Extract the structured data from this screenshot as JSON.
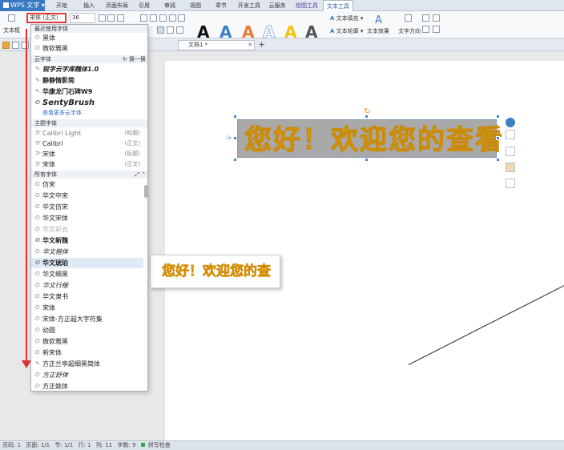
{
  "menubar": {
    "app_label": "WPS 文字",
    "tabs": [
      {
        "label": "开始"
      },
      {
        "label": "插入"
      },
      {
        "label": "页面布局"
      },
      {
        "label": "引用"
      },
      {
        "label": "审阅"
      },
      {
        "label": "视图"
      },
      {
        "label": "章节"
      },
      {
        "label": "开发工具"
      },
      {
        "label": "云服务"
      },
      {
        "label": "绘图工具"
      },
      {
        "label": "文本工具"
      }
    ],
    "active_tab": "文本工具"
  },
  "ribbon": {
    "font_name": "宋体 (正文)",
    "font_size": "36",
    "textbox_label": "文本框",
    "text_fill_label": "文本填充",
    "text_outline_label": "文本轮廓",
    "text_effect_label": "文本效果",
    "text_direction_label": "文字方向",
    "style_glyph": "A",
    "style_colors": [
      "#111111",
      "#3c7fc6",
      "#e87a3a",
      "#9ab4d6",
      "#f1c40f",
      "#555555"
    ]
  },
  "document_tab": {
    "label": "文档1 *"
  },
  "wordart": {
    "text": "您好！欢迎您的查看",
    "fill_color": "#e3ad19"
  },
  "preview": {
    "text": "您好！欢迎您的查"
  },
  "font_dropdown": {
    "recent_header": "最近使用字体",
    "recent": [
      {
        "name": "黑体"
      },
      {
        "name": "微软雅黑"
      }
    ],
    "cloud_header": "云字体",
    "cloud_action": "换一换",
    "cloud": [
      {
        "name": "锐字云字库魏体1.0"
      },
      {
        "name": "静静情影简"
      },
      {
        "name": "华康龙门石碑W9"
      },
      {
        "name": "SentyBrush"
      }
    ],
    "cloud_more": "查看更多云字体",
    "theme_header": "主题字体",
    "theme": [
      {
        "name": "Calibri Light",
        "tag": "(标题)"
      },
      {
        "name": "Calibri",
        "tag": "(正文)"
      },
      {
        "name": "宋体",
        "tag": "(标题)"
      },
      {
        "name": "宋体",
        "tag": "(正文)"
      }
    ],
    "all_header": "所有字体",
    "all": [
      {
        "name": "仿宋"
      },
      {
        "name": "华文中宋"
      },
      {
        "name": "华文仿宋"
      },
      {
        "name": "华文宋体"
      },
      {
        "name": "华文彩云"
      },
      {
        "name": "华文新魏"
      },
      {
        "name": "华文楷体"
      },
      {
        "name": "华文琥珀"
      },
      {
        "name": "华文细黑"
      },
      {
        "name": "华文行楷"
      },
      {
        "name": "华文隶书"
      },
      {
        "name": "宋体"
      },
      {
        "name": "宋体-方正超大字符集"
      },
      {
        "name": "幼圆"
      },
      {
        "name": "微软雅黑"
      },
      {
        "name": "新宋体"
      },
      {
        "name": "方正兰亭超细黑简体"
      },
      {
        "name": "方正舒体"
      },
      {
        "name": "方正姚体"
      }
    ],
    "selected": "华文琥珀"
  },
  "statusbar": {
    "page": "页码: 1",
    "pages": "页面: 1/1",
    "section": "节: 1/1",
    "row": "行: 1",
    "col": "列: 11",
    "words": "字数: 9",
    "spell": "拼写检查"
  }
}
